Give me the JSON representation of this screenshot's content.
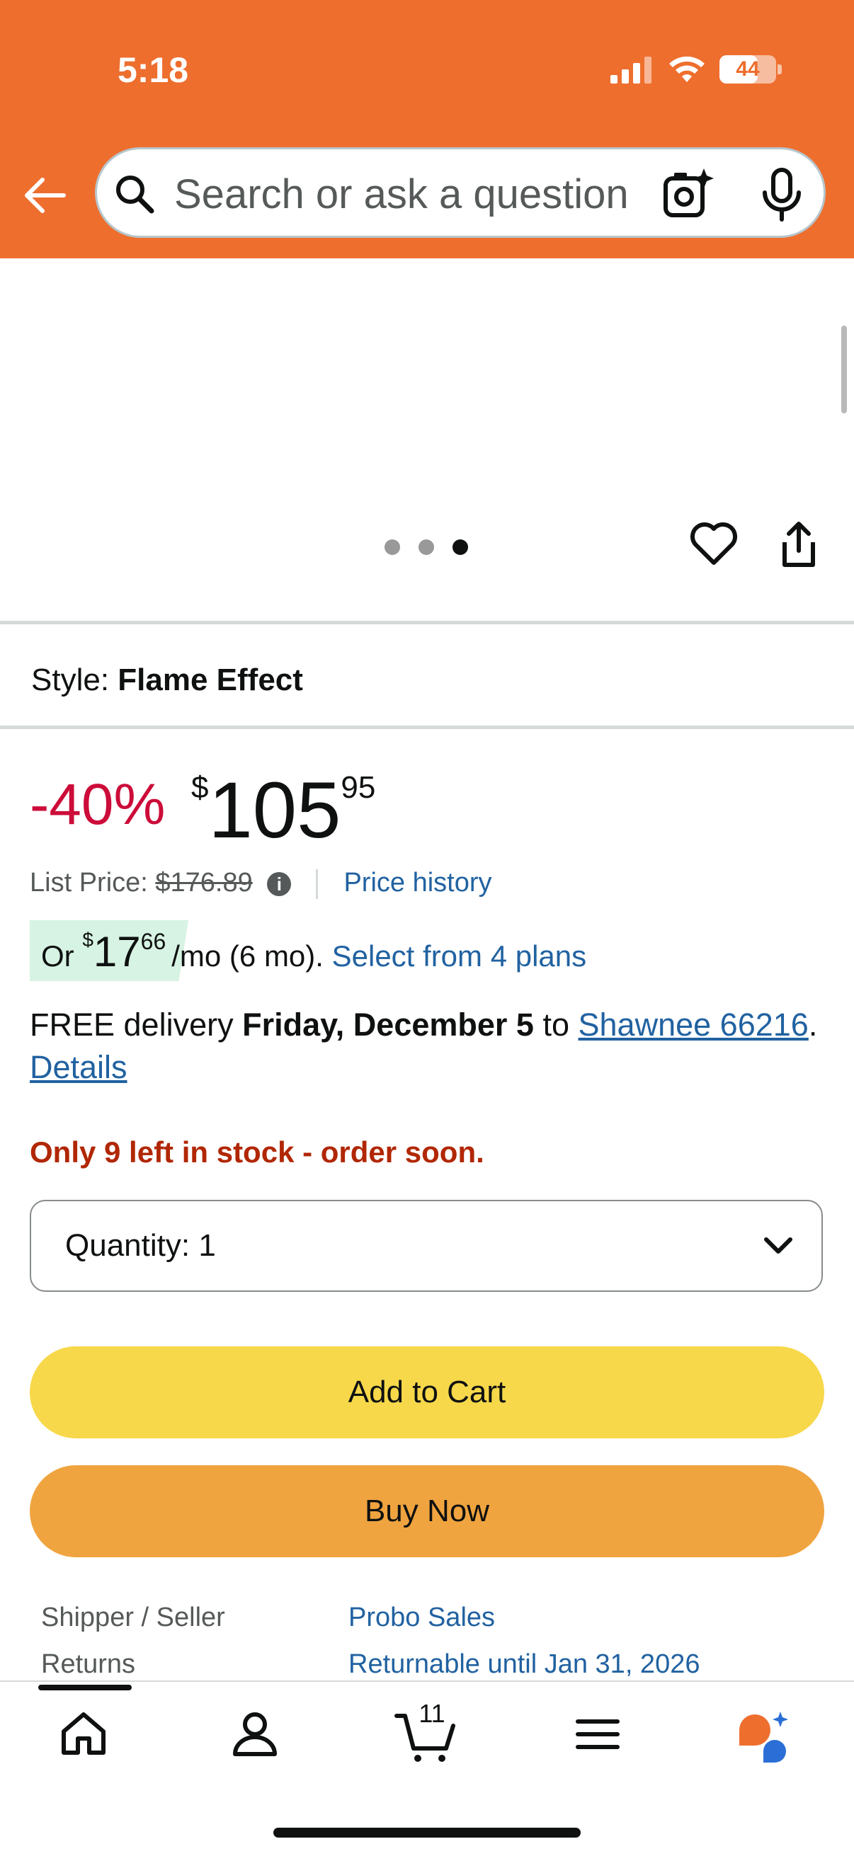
{
  "status_bar": {
    "time": "5:18",
    "battery": "44"
  },
  "header": {
    "search_placeholder": "Search or ask a question",
    "back_icon": "back-arrow-icon",
    "camera_icon": "camera-sparkle-icon",
    "mic_icon": "microphone-icon"
  },
  "gallery": {
    "image_count": 3,
    "active_index": 2
  },
  "style": {
    "label": "Style:",
    "value": "Flame Effect"
  },
  "price": {
    "discount": "-40%",
    "currency": "$",
    "whole": "105",
    "fraction": "95",
    "list_price_label": "List Price:",
    "list_price_value": "$176.89",
    "info_icon": "i",
    "price_history": "Price history"
  },
  "installment": {
    "prefix": "Or",
    "currency": "$",
    "whole": "17",
    "fraction": "66",
    "suffix": "/mo (6 mo).",
    "plans_link": "Select from 4 plans"
  },
  "delivery": {
    "prefix": "FREE delivery",
    "date": "Friday, December 5",
    "to": "to",
    "location": "Shawnee 66216",
    "period": ".",
    "details": "Details"
  },
  "stock": "Only 9 left in stock - order soon.",
  "quantity": {
    "label": "Quantity:",
    "value": "1"
  },
  "buttons": {
    "add_to_cart": "Add to Cart",
    "buy_now": "Buy Now"
  },
  "info_rows": [
    {
      "key": "Shipper / Seller",
      "value": "Probo Sales"
    },
    {
      "key": "Returns",
      "value": "Returnable until Jan 31, 2026"
    }
  ],
  "bottom_nav": {
    "cart_count": "11",
    "items": [
      "home-icon",
      "account-icon",
      "cart-icon",
      "menu-icon",
      "rufus-assistant-icon"
    ]
  },
  "colors": {
    "header_bg": "#ee6e2e",
    "discount": "#cc0c39",
    "link": "#2162a1",
    "stock": "#b12704",
    "add_to_cart": "#f7d84a",
    "buy_now": "#f0a43f"
  }
}
